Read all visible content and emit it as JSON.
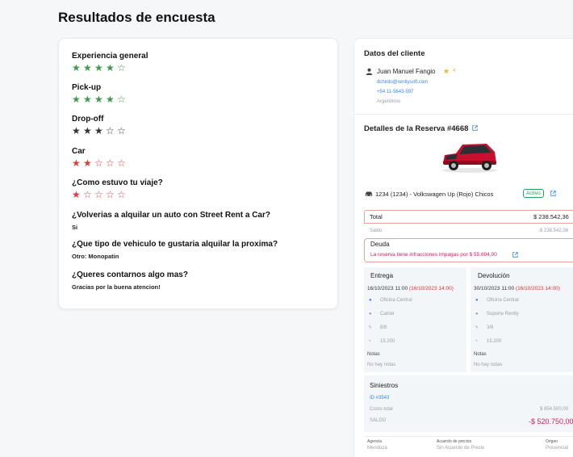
{
  "page": {
    "title": "Resultados de encuesta"
  },
  "colors": {
    "green": "#3d9a4a",
    "dark": "#333333",
    "red": "#e03a3a",
    "blue": "#3b82f6"
  },
  "survey": {
    "questions": [
      {
        "label": "Experiencia general",
        "rating": 4,
        "color": "green"
      },
      {
        "label": "Pick-up",
        "rating": 4,
        "color": "green"
      },
      {
        "label": "Drop-off",
        "rating": 3,
        "color": "dark"
      },
      {
        "label": "Car",
        "rating": 2,
        "color": "red"
      },
      {
        "label": "¿Como estuvo tu viaje?",
        "rating": 1,
        "color": "red"
      },
      {
        "label": "¿Volverias a alquilar un auto con Street Rent a Car?",
        "answer": "Si"
      },
      {
        "label": "¿Que tipo de vehiculo te gustaria alquilar la proxima?",
        "answer": "Otro: Monopatin"
      },
      {
        "label": "¿Queres contarnos algo mas?",
        "answer": "Gracias por la buena atencion!"
      }
    ]
  },
  "client": {
    "section_title": "Datos del cliente",
    "name": "Juan Manuel Fangio",
    "score": "4",
    "email": "dchirdo@rentlysoft.com",
    "phone": "+54 11-5643-597",
    "country": "Argentinno"
  },
  "reservation": {
    "title": "Detalles de la Reserva #4668",
    "vehicle": "1234 (1234) - Volkswagen Up (Rojo) Chicos",
    "status": "Activo",
    "total_label": "Total",
    "total_value": "$ 238.542,36",
    "saldo_label": "Saldo",
    "saldo_value": "-$ 238.542,36",
    "deuda_title": "Deuda",
    "deuda_text": "La reserva tiene infracciones impagas por $ 55.694,00",
    "entrega": {
      "title": "Entrega",
      "date": "16/10/2023 11:00",
      "date_red": "(16/10/2023 14:00)",
      "location": "Oficina Central",
      "person": "Catriel",
      "fuel": "8/8",
      "km": "15.200",
      "notes_label": "Notas",
      "notes": "No hay notas"
    },
    "devolucion": {
      "title": "Devolución",
      "date": "30/10/2023 11:00",
      "date_red": "(16/10/2023 14:00)",
      "location": "Oficina Central",
      "person": "Soporte Rently",
      "fuel": "3/8",
      "km": "15.200",
      "notes_label": "Notas",
      "notes": "No hay notas"
    },
    "siniestros": {
      "title": "Siniestros",
      "id": "ID #3543",
      "costo_label": "Costo total",
      "costo_value": "$ 854.500,00",
      "saldo_label": "SALDO",
      "saldo_value": "-$ 520.750,00"
    },
    "footer": {
      "agencia_label": "Agencia",
      "agencia_value": "Mendoza",
      "precios_label": "Acuerdo de precios",
      "precios_value": "Sin Acuerdo de Precio",
      "origen_label": "Origen",
      "origen_value": "Presencial"
    }
  }
}
